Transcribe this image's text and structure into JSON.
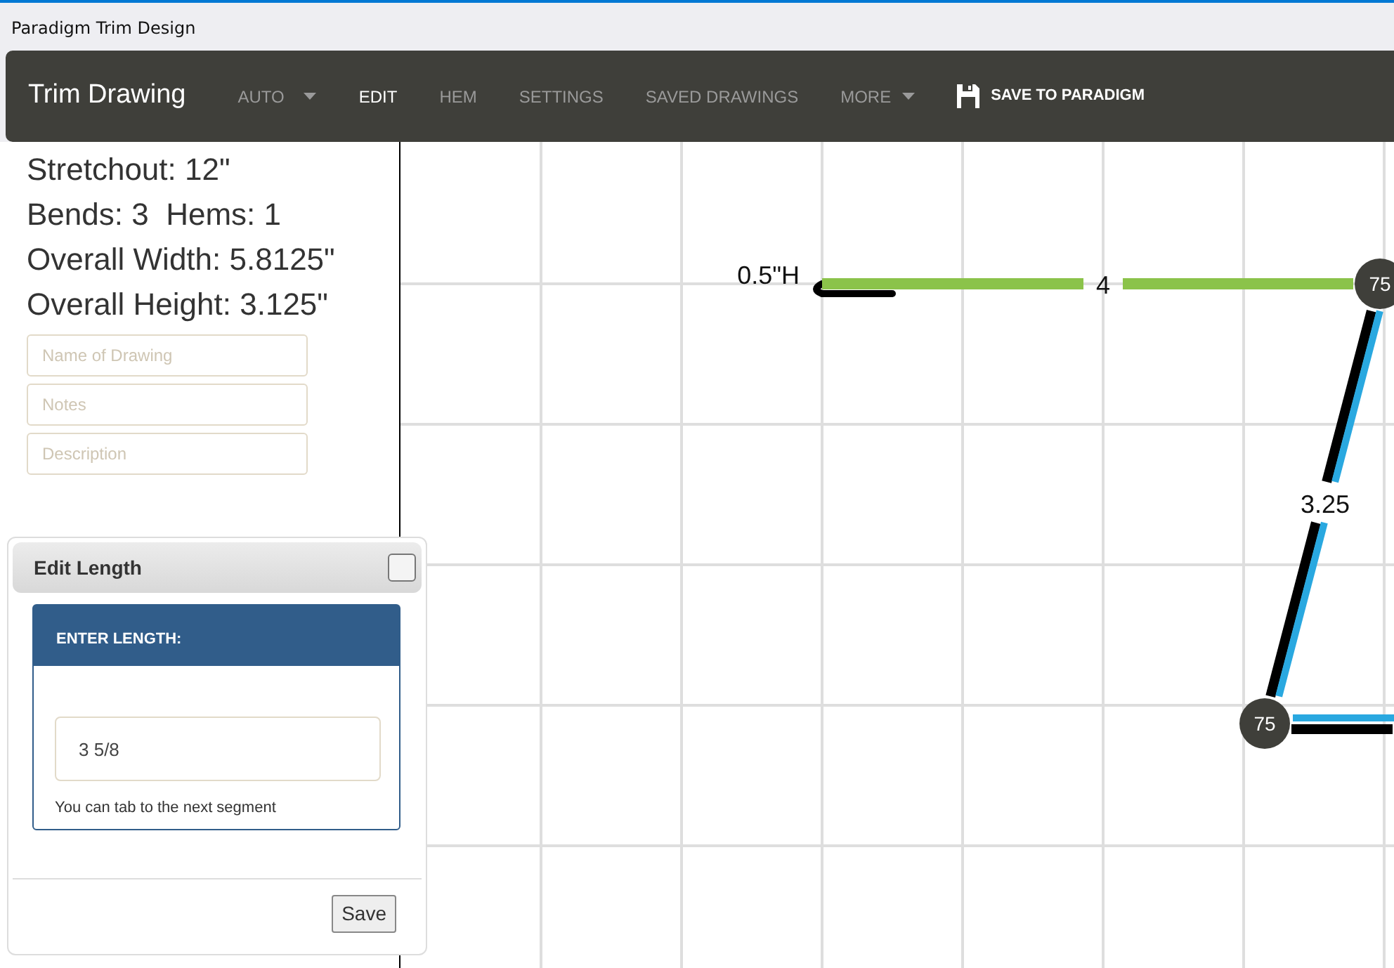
{
  "window": {
    "title": "Paradigm Trim Design"
  },
  "navbar": {
    "brand": "Trim Drawing",
    "items": [
      {
        "label": "AUTO",
        "kind": "dropdown",
        "selected": false
      },
      {
        "label": "EDIT",
        "kind": "link",
        "selected": true
      },
      {
        "label": "HEM",
        "kind": "link",
        "selected": false
      },
      {
        "label": "SETTINGS",
        "kind": "link",
        "selected": false
      },
      {
        "label": "SAVED DRAWINGS",
        "kind": "link",
        "selected": false
      },
      {
        "label": "MORE",
        "kind": "dropdown",
        "selected": false
      },
      {
        "label": "SAVE TO PARADIGM",
        "kind": "action"
      }
    ]
  },
  "summary": [
    "Stretchout: 12\"",
    "Bends: 3  Hems: 1",
    "Overall Width: 5.8125\"",
    "Overall Height: 3.125\""
  ],
  "fields": [
    {
      "placeholder": "Name of Drawing"
    },
    {
      "placeholder": "Notes"
    },
    {
      "placeholder": "Description"
    }
  ],
  "dialog": {
    "title": "Edit Length",
    "checked": false,
    "panel_title": "ENTER LENGTH:",
    "value": "3 5/8",
    "hint": "You can tab to the next segment",
    "button": "Save"
  },
  "drawing": {
    "hem_label": "0.5\"H",
    "segments": [
      {
        "label": "4",
        "color": "#8bc34a"
      },
      {
        "label": "3.25",
        "color": "#29a8e0"
      },
      {
        "color": "#29a8e0"
      }
    ],
    "nodes": [
      "75",
      "75"
    ]
  }
}
